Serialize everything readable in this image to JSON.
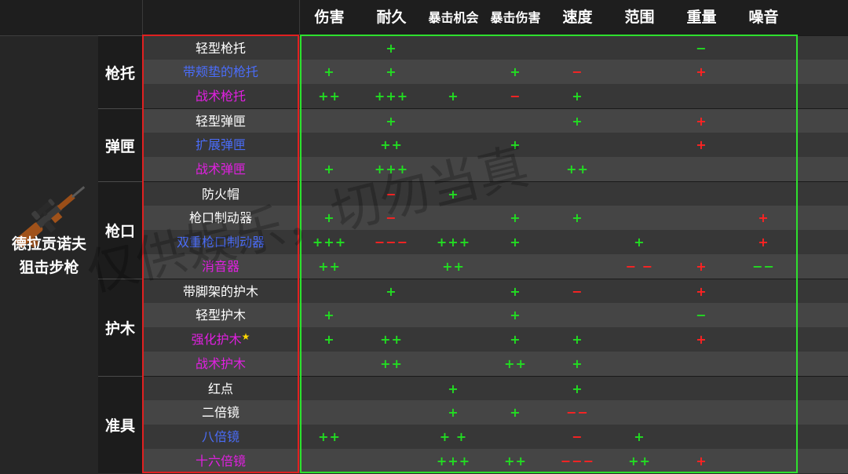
{
  "colors": {
    "default_name": "#ffffff",
    "blue_name": "#4a6cf7",
    "purple_name": "#e020e0",
    "plus": "#22dd22",
    "minus": "#ff2222",
    "green_minus": "#22dd22",
    "red_plus": "#ff2222"
  },
  "headers": [
    "伤害",
    "耐久",
    "暴击机会",
    "暴击伤害",
    "速度",
    "范围",
    "重量",
    "噪音"
  ],
  "weapon": {
    "icon": "sniper-rifle-icon",
    "name_line1": "德拉贡诺夫",
    "name_line2": "狙击步枪"
  },
  "categories": [
    {
      "name": "枪托",
      "rows": [
        {
          "name": "轻型枪托",
          "color": "white",
          "stats": [
            "",
            "+",
            "",
            "",
            "",
            "",
            "−",
            ""
          ],
          "stat_colors": [
            "",
            "g",
            "",
            "",
            "",
            "",
            "g",
            ""
          ]
        },
        {
          "name": "带颊垫的枪托",
          "color": "blue",
          "stats": [
            "+",
            "+",
            "",
            "+",
            "−",
            "",
            "+",
            ""
          ],
          "stat_colors": [
            "g",
            "g",
            "",
            "g",
            "r",
            "",
            "r",
            ""
          ]
        },
        {
          "name": "战术枪托",
          "color": "purple",
          "stats": [
            "++",
            "+++",
            "+",
            "−",
            "+",
            "",
            "",
            ""
          ],
          "stat_colors": [
            "g",
            "g",
            "g",
            "r",
            "g",
            "",
            "",
            ""
          ]
        }
      ]
    },
    {
      "name": "弹匣",
      "rows": [
        {
          "name": "轻型弹匣",
          "color": "white",
          "stats": [
            "",
            "+",
            "",
            "",
            "+",
            "",
            "+",
            ""
          ],
          "stat_colors": [
            "",
            "g",
            "",
            "",
            "g",
            "",
            "r",
            ""
          ]
        },
        {
          "name": "扩展弹匣",
          "color": "blue",
          "stats": [
            "",
            "++",
            "",
            "+",
            "",
            "",
            "+",
            ""
          ],
          "stat_colors": [
            "",
            "g",
            "",
            "g",
            "",
            "",
            "r",
            ""
          ]
        },
        {
          "name": "战术弹匣",
          "color": "purple",
          "stats": [
            "+",
            "+++",
            "",
            "",
            "++",
            "",
            "",
            ""
          ],
          "stat_colors": [
            "g",
            "g",
            "",
            "",
            "g",
            "",
            "",
            ""
          ]
        }
      ]
    },
    {
      "name": "枪口",
      "rows": [
        {
          "name": "防火帽",
          "color": "white",
          "stats": [
            "",
            "−",
            "+",
            "",
            "",
            "",
            "",
            ""
          ],
          "stat_colors": [
            "",
            "r",
            "g",
            "",
            "",
            "",
            "",
            ""
          ]
        },
        {
          "name": "枪口制动器",
          "color": "white",
          "stats": [
            "+",
            "−",
            "",
            "+",
            "+",
            "",
            "",
            "+"
          ],
          "stat_colors": [
            "g",
            "r",
            "",
            "g",
            "g",
            "",
            "",
            "r"
          ]
        },
        {
          "name": "双重枪口制动器",
          "color": "blue",
          "stats": [
            "+++",
            "−−−",
            "+++",
            "+",
            "",
            "+",
            "",
            "+"
          ],
          "stat_colors": [
            "g",
            "r",
            "g",
            "g",
            "",
            "g",
            "",
            "r"
          ]
        },
        {
          "name": "消音器",
          "color": "purple",
          "stats": [
            "++",
            "",
            "++",
            "",
            "",
            "− −",
            "+",
            "−−"
          ],
          "stat_colors": [
            "g",
            "",
            "g",
            "",
            "",
            "r",
            "r",
            "g"
          ]
        }
      ]
    },
    {
      "name": "护木",
      "rows": [
        {
          "name": "带脚架的护木",
          "color": "white",
          "star": false,
          "stats": [
            "",
            "+",
            "",
            "+",
            "−",
            "",
            "+",
            ""
          ],
          "stat_colors": [
            "",
            "g",
            "",
            "g",
            "r",
            "",
            "r",
            ""
          ]
        },
        {
          "name": "轻型护木",
          "color": "white",
          "star": false,
          "stats": [
            "+",
            "",
            "",
            "+",
            "",
            "",
            "−",
            ""
          ],
          "stat_colors": [
            "g",
            "",
            "",
            "g",
            "",
            "",
            "g",
            ""
          ]
        },
        {
          "name": "强化护木",
          "color": "purple",
          "star": true,
          "stats": [
            "+",
            "++",
            "",
            "+",
            "+",
            "",
            "+",
            ""
          ],
          "stat_colors": [
            "g",
            "g",
            "",
            "g",
            "g",
            "",
            "r",
            ""
          ]
        },
        {
          "name": "战术护木",
          "color": "purple",
          "star": false,
          "stats": [
            "",
            "++",
            "",
            "++",
            "+",
            "",
            "",
            ""
          ],
          "stat_colors": [
            "",
            "g",
            "",
            "g",
            "g",
            "",
            "",
            ""
          ]
        }
      ]
    },
    {
      "name": "准具",
      "rows": [
        {
          "name": "红点",
          "color": "white",
          "stats": [
            "",
            "",
            "+",
            "",
            "+",
            "",
            "",
            ""
          ],
          "stat_colors": [
            "",
            "",
            "g",
            "",
            "g",
            "",
            "",
            ""
          ]
        },
        {
          "name": "二倍镜",
          "color": "white",
          "stats": [
            "",
            "",
            "+",
            "+",
            "−−",
            "",
            "",
            ""
          ],
          "stat_colors": [
            "",
            "",
            "g",
            "g",
            "r",
            "",
            "",
            ""
          ]
        },
        {
          "name": "八倍镜",
          "color": "blue",
          "stats": [
            "++",
            "",
            "+ +",
            "",
            "−",
            "+",
            "",
            ""
          ],
          "stat_colors": [
            "g",
            "",
            "g",
            "",
            "r",
            "g",
            "",
            ""
          ]
        },
        {
          "name": "十六倍镜",
          "color": "purple",
          "stats": [
            "",
            "",
            "+++",
            "++",
            "−−−",
            "++",
            "+",
            ""
          ],
          "stat_colors": [
            "",
            "",
            "g",
            "g",
            "r",
            "g",
            "r",
            ""
          ]
        }
      ]
    }
  ],
  "watermark": "仅供娱乐，切勿当真"
}
